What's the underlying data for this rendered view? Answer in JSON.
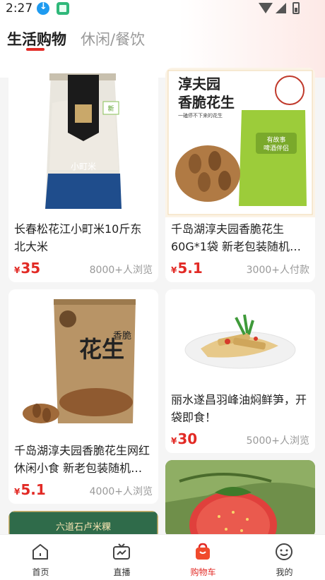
{
  "status_bar": {
    "time": "2:27"
  },
  "tabs": [
    {
      "label": "生活购物",
      "active": true
    },
    {
      "label": "休闲/餐饮",
      "active": false
    }
  ],
  "products": [
    {
      "title": "长春松花江小町米10斤东北大米",
      "currency": "¥",
      "price": "35",
      "stat": "8000+人浏览",
      "image": "rice-bag-image"
    },
    {
      "title": "千岛湖淳夫园香脆花生60G*1袋 新老包装随机发货",
      "currency": "¥",
      "price": "5.1",
      "stat": "3000+人付款",
      "image": "peanut-green-bag-image",
      "image_text": {
        "brand": "淳夫园",
        "name": "香脆花生",
        "slogan": "一磕停不下来的花生",
        "bag": "有故事 啤酒伴侣"
      }
    },
    {
      "title": "千岛湖淳夫园香脆花生网红休闲小食 新老包装随机发货",
      "currency": "¥",
      "price": "5.1",
      "stat": "4000+人浏览",
      "image": "peanut-kraft-bag-image",
      "image_text": {
        "big": "花生",
        "small": "香脆"
      }
    },
    {
      "title": "丽水遂昌羽峰油焖鲜笋，开袋即食！",
      "currency": "¥",
      "price": "30",
      "stat": "5000+人浏览",
      "image": "bamboo-shoot-plate-image"
    },
    {
      "title": "",
      "image": "strawberry-image"
    },
    {
      "title": "",
      "image": "rice-cake-banner-image",
      "image_text": {
        "banner": "六道石卢米粿"
      }
    }
  ],
  "bottom_nav": [
    {
      "label": "首页",
      "icon": "home-icon",
      "active": false
    },
    {
      "label": "直播",
      "icon": "tv-icon",
      "active": false
    },
    {
      "label": "购物车",
      "icon": "shopping-bag-icon",
      "active": true
    },
    {
      "label": "我的",
      "icon": "smiley-face-icon",
      "active": false
    }
  ],
  "colors": {
    "accent": "#e22a25",
    "muted": "#999999",
    "background": "#f5f5f5"
  }
}
